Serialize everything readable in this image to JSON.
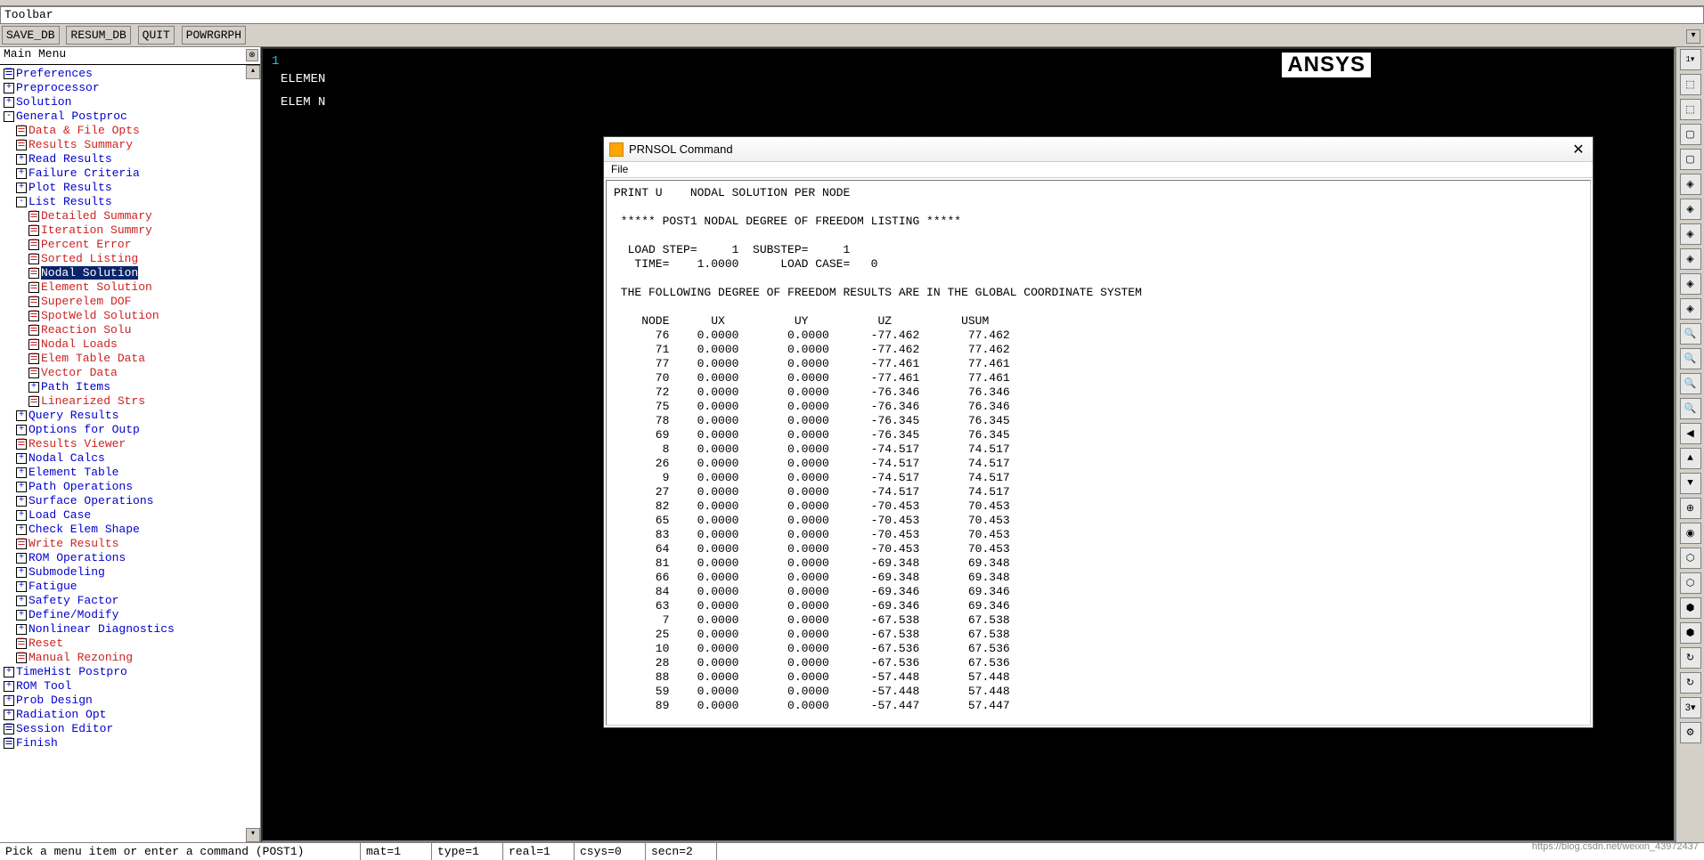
{
  "toolbar_label": "Toolbar",
  "toolbar": {
    "save_db": "SAVE_DB",
    "resum_db": "RESUM_DB",
    "quit": "QUIT",
    "powrgrph": "POWRGRPH"
  },
  "main_menu_label": "Main Menu",
  "tree": [
    {
      "lvl": 0,
      "ic": "☰",
      "cls": "blue",
      "label": "Preferences"
    },
    {
      "lvl": 0,
      "ic": "+",
      "cls": "blue",
      "label": "Preprocessor"
    },
    {
      "lvl": 0,
      "ic": "+",
      "cls": "blue",
      "label": "Solution"
    },
    {
      "lvl": 0,
      "ic": "-",
      "cls": "blue",
      "label": "General Postproc"
    },
    {
      "lvl": 1,
      "ic": "☰",
      "cls": "red",
      "label": "Data & File Opts"
    },
    {
      "lvl": 1,
      "ic": "☰",
      "cls": "red",
      "label": "Results Summary"
    },
    {
      "lvl": 1,
      "ic": "+",
      "cls": "blue",
      "label": "Read Results"
    },
    {
      "lvl": 1,
      "ic": "+",
      "cls": "blue",
      "label": "Failure Criteria"
    },
    {
      "lvl": 1,
      "ic": "+",
      "cls": "blue",
      "label": "Plot Results"
    },
    {
      "lvl": 1,
      "ic": "-",
      "cls": "blue",
      "label": "List Results"
    },
    {
      "lvl": 2,
      "ic": "☰",
      "cls": "red",
      "label": "Detailed Summary"
    },
    {
      "lvl": 2,
      "ic": "☰",
      "cls": "red",
      "label": "Iteration Summry"
    },
    {
      "lvl": 2,
      "ic": "☰",
      "cls": "red",
      "label": "Percent Error"
    },
    {
      "lvl": 2,
      "ic": "☰",
      "cls": "red",
      "label": "Sorted Listing"
    },
    {
      "lvl": 2,
      "ic": "☰",
      "cls": "red sel",
      "label": "Nodal Solution"
    },
    {
      "lvl": 2,
      "ic": "☰",
      "cls": "red",
      "label": "Element Solution"
    },
    {
      "lvl": 2,
      "ic": "☰",
      "cls": "red",
      "label": "Superelem DOF"
    },
    {
      "lvl": 2,
      "ic": "☰",
      "cls": "red",
      "label": "SpotWeld Solution"
    },
    {
      "lvl": 2,
      "ic": "☰",
      "cls": "red",
      "label": "Reaction Solu"
    },
    {
      "lvl": 2,
      "ic": "☰",
      "cls": "red",
      "label": "Nodal Loads"
    },
    {
      "lvl": 2,
      "ic": "☰",
      "cls": "red",
      "label": "Elem Table Data"
    },
    {
      "lvl": 2,
      "ic": "☰",
      "cls": "red",
      "label": "Vector Data"
    },
    {
      "lvl": 2,
      "ic": "+",
      "cls": "blue",
      "label": "Path Items"
    },
    {
      "lvl": 2,
      "ic": "☰",
      "cls": "red",
      "label": "Linearized Strs"
    },
    {
      "lvl": 1,
      "ic": "+",
      "cls": "blue",
      "label": "Query Results"
    },
    {
      "lvl": 1,
      "ic": "+",
      "cls": "blue",
      "label": "Options for Outp"
    },
    {
      "lvl": 1,
      "ic": "☰",
      "cls": "red",
      "label": "Results Viewer"
    },
    {
      "lvl": 1,
      "ic": "+",
      "cls": "blue",
      "label": "Nodal Calcs"
    },
    {
      "lvl": 1,
      "ic": "+",
      "cls": "blue",
      "label": "Element Table"
    },
    {
      "lvl": 1,
      "ic": "+",
      "cls": "blue",
      "label": "Path Operations"
    },
    {
      "lvl": 1,
      "ic": "+",
      "cls": "blue",
      "label": "Surface Operations"
    },
    {
      "lvl": 1,
      "ic": "+",
      "cls": "blue",
      "label": "Load Case"
    },
    {
      "lvl": 1,
      "ic": "+",
      "cls": "blue",
      "label": "Check Elem Shape"
    },
    {
      "lvl": 1,
      "ic": "☰",
      "cls": "red",
      "label": "Write Results"
    },
    {
      "lvl": 1,
      "ic": "+",
      "cls": "blue",
      "label": "ROM Operations"
    },
    {
      "lvl": 1,
      "ic": "+",
      "cls": "blue",
      "label": "Submodeling"
    },
    {
      "lvl": 1,
      "ic": "+",
      "cls": "blue",
      "label": "Fatigue"
    },
    {
      "lvl": 1,
      "ic": "+",
      "cls": "blue",
      "label": "Safety Factor"
    },
    {
      "lvl": 1,
      "ic": "+",
      "cls": "blue",
      "label": "Define/Modify"
    },
    {
      "lvl": 1,
      "ic": "+",
      "cls": "blue",
      "label": "Nonlinear Diagnostics"
    },
    {
      "lvl": 1,
      "ic": "☰",
      "cls": "red",
      "label": "Reset"
    },
    {
      "lvl": 1,
      "ic": "☰",
      "cls": "red",
      "label": "Manual Rezoning"
    },
    {
      "lvl": 0,
      "ic": "+",
      "cls": "blue",
      "label": "TimeHist Postpro"
    },
    {
      "lvl": 0,
      "ic": "+",
      "cls": "blue",
      "label": "ROM Tool"
    },
    {
      "lvl": 0,
      "ic": "+",
      "cls": "blue",
      "label": "Prob Design"
    },
    {
      "lvl": 0,
      "ic": "+",
      "cls": "blue",
      "label": "Radiation Opt"
    },
    {
      "lvl": 0,
      "ic": "☰",
      "cls": "blue",
      "label": "Session Editor"
    },
    {
      "lvl": 0,
      "ic": "☰",
      "cls": "blue",
      "label": "Finish"
    }
  ],
  "graphics": {
    "num": "1",
    "line1": "ELEMEN",
    "line2": "ELEM N",
    "logo": "ANSYS"
  },
  "prnsol": {
    "title": "PRNSOL  Command",
    "file_menu": "File",
    "header_lines": [
      "PRINT U    NODAL SOLUTION PER NODE",
      "",
      " ***** POST1 NODAL DEGREE OF FREEDOM LISTING *****",
      "",
      "  LOAD STEP=     1  SUBSTEP=     1",
      "   TIME=    1.0000      LOAD CASE=   0",
      "",
      " THE FOLLOWING DEGREE OF FREEDOM RESULTS ARE IN THE GLOBAL COORDINATE SYSTEM",
      ""
    ],
    "col_header": "    NODE      UX          UY          UZ          USUM  ",
    "rows": [
      {
        "n": 76,
        "ux": "0.0000",
        "uy": "0.0000",
        "uz": "-77.462",
        "usum": "77.462"
      },
      {
        "n": 71,
        "ux": "0.0000",
        "uy": "0.0000",
        "uz": "-77.462",
        "usum": "77.462"
      },
      {
        "n": 77,
        "ux": "0.0000",
        "uy": "0.0000",
        "uz": "-77.461",
        "usum": "77.461"
      },
      {
        "n": 70,
        "ux": "0.0000",
        "uy": "0.0000",
        "uz": "-77.461",
        "usum": "77.461"
      },
      {
        "n": 72,
        "ux": "0.0000",
        "uy": "0.0000",
        "uz": "-76.346",
        "usum": "76.346"
      },
      {
        "n": 75,
        "ux": "0.0000",
        "uy": "0.0000",
        "uz": "-76.346",
        "usum": "76.346"
      },
      {
        "n": 78,
        "ux": "0.0000",
        "uy": "0.0000",
        "uz": "-76.345",
        "usum": "76.345"
      },
      {
        "n": 69,
        "ux": "0.0000",
        "uy": "0.0000",
        "uz": "-76.345",
        "usum": "76.345"
      },
      {
        "n": 8,
        "ux": "0.0000",
        "uy": "0.0000",
        "uz": "-74.517",
        "usum": "74.517"
      },
      {
        "n": 26,
        "ux": "0.0000",
        "uy": "0.0000",
        "uz": "-74.517",
        "usum": "74.517"
      },
      {
        "n": 9,
        "ux": "0.0000",
        "uy": "0.0000",
        "uz": "-74.517",
        "usum": "74.517"
      },
      {
        "n": 27,
        "ux": "0.0000",
        "uy": "0.0000",
        "uz": "-74.517",
        "usum": "74.517"
      },
      {
        "n": 82,
        "ux": "0.0000",
        "uy": "0.0000",
        "uz": "-70.453",
        "usum": "70.453"
      },
      {
        "n": 65,
        "ux": "0.0000",
        "uy": "0.0000",
        "uz": "-70.453",
        "usum": "70.453"
      },
      {
        "n": 83,
        "ux": "0.0000",
        "uy": "0.0000",
        "uz": "-70.453",
        "usum": "70.453"
      },
      {
        "n": 64,
        "ux": "0.0000",
        "uy": "0.0000",
        "uz": "-70.453",
        "usum": "70.453"
      },
      {
        "n": 81,
        "ux": "0.0000",
        "uy": "0.0000",
        "uz": "-69.348",
        "usum": "69.348"
      },
      {
        "n": 66,
        "ux": "0.0000",
        "uy": "0.0000",
        "uz": "-69.348",
        "usum": "69.348"
      },
      {
        "n": 84,
        "ux": "0.0000",
        "uy": "0.0000",
        "uz": "-69.346",
        "usum": "69.346"
      },
      {
        "n": 63,
        "ux": "0.0000",
        "uy": "0.0000",
        "uz": "-69.346",
        "usum": "69.346"
      },
      {
        "n": 7,
        "ux": "0.0000",
        "uy": "0.0000",
        "uz": "-67.538",
        "usum": "67.538"
      },
      {
        "n": 25,
        "ux": "0.0000",
        "uy": "0.0000",
        "uz": "-67.538",
        "usum": "67.538"
      },
      {
        "n": 10,
        "ux": "0.0000",
        "uy": "0.0000",
        "uz": "-67.536",
        "usum": "67.536"
      },
      {
        "n": 28,
        "ux": "0.0000",
        "uy": "0.0000",
        "uz": "-67.536",
        "usum": "67.536"
      },
      {
        "n": 88,
        "ux": "0.0000",
        "uy": "0.0000",
        "uz": "-57.448",
        "usum": "57.448"
      },
      {
        "n": 59,
        "ux": "0.0000",
        "uy": "0.0000",
        "uz": "-57.448",
        "usum": "57.448"
      },
      {
        "n": 89,
        "ux": "0.0000",
        "uy": "0.0000",
        "uz": "-57.447",
        "usum": "57.447"
      }
    ]
  },
  "right_icons": [
    "⬚",
    "⬚",
    "▢",
    "▢",
    "◈",
    "◈",
    "◈",
    "◈",
    "◈",
    "◈",
    "🔍",
    "🔍",
    "🔍",
    "🔍",
    "◀",
    "▲",
    "▼",
    "⊕",
    "◉",
    "⬡",
    "⬡",
    "⬢",
    "⬢",
    "↻",
    "↻",
    "3▾",
    "⚙"
  ],
  "status": {
    "prompt": "Pick a menu item or enter a command (POST1)",
    "mat": "mat=1",
    "type": "type=1",
    "real": "real=1",
    "csys": "csys=0",
    "secn": "secn=2"
  },
  "watermark": "https://blog.csdn.net/weixin_43972437"
}
